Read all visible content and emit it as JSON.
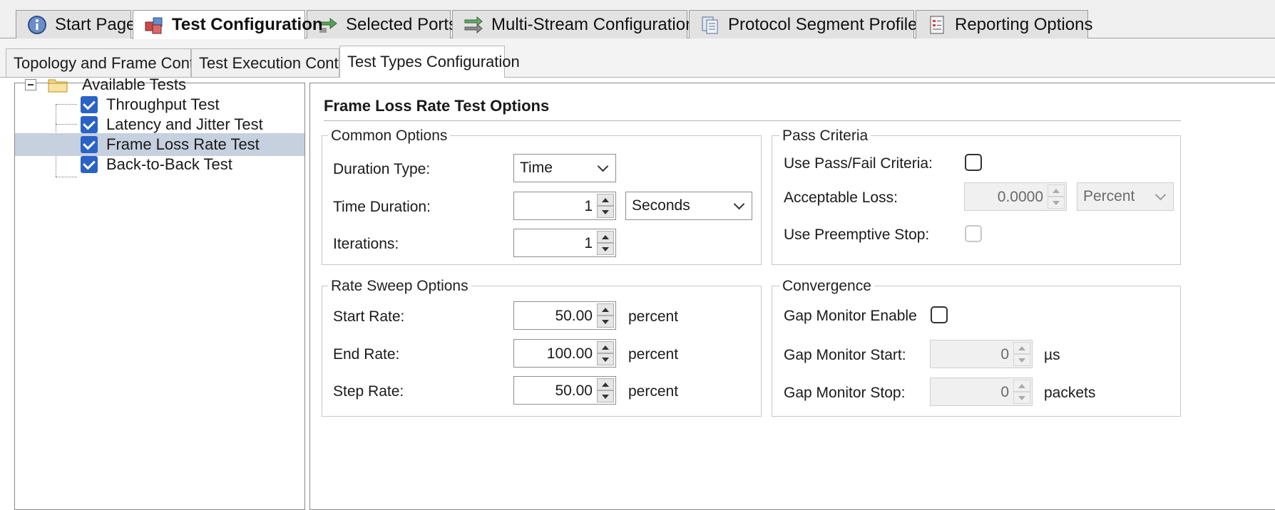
{
  "top_tabs": [
    {
      "label": "Start Page",
      "icon": "info-icon"
    },
    {
      "label": "Test Configuration",
      "icon": "cubes-icon",
      "active": true
    },
    {
      "label": "Selected Ports",
      "icon": "ports-arrows-icon"
    },
    {
      "label": "Multi-Stream Configuration",
      "icon": "multi-stream-icon"
    },
    {
      "label": "Protocol Segment Profiles",
      "icon": "documents-icon"
    },
    {
      "label": "Reporting Options",
      "icon": "report-icon"
    }
  ],
  "sub_tabs": [
    {
      "label": "Topology and Frame Content"
    },
    {
      "label": "Test Execution Control"
    },
    {
      "label": "Test Types Configuration",
      "active": true
    }
  ],
  "tree": {
    "root_label": "Available Tests",
    "items": [
      {
        "label": "Throughput Test",
        "checked": true
      },
      {
        "label": "Latency and Jitter Test",
        "checked": true
      },
      {
        "label": "Frame Loss Rate Test",
        "checked": true,
        "selected": true
      },
      {
        "label": "Back-to-Back Test",
        "checked": true
      }
    ]
  },
  "panel": {
    "title": "Frame Loss Rate Test Options",
    "common_options": {
      "group_label": "Common Options",
      "duration_type_label": "Duration Type:",
      "duration_type_value": "Time",
      "time_duration_label": "Time Duration:",
      "time_duration_value": "1",
      "time_unit_value": "Seconds",
      "iterations_label": "Iterations:",
      "iterations_value": "1"
    },
    "pass_criteria": {
      "group_label": "Pass Criteria",
      "use_pass_fail_label": "Use Pass/Fail Criteria:",
      "use_pass_fail_checked": false,
      "acceptable_loss_label": "Acceptable Loss:",
      "acceptable_loss_value": "0.0000",
      "acceptable_loss_unit": "Percent",
      "preemptive_stop_label": "Use Preemptive Stop:",
      "preemptive_stop_checked": false
    },
    "rate_sweep": {
      "group_label": "Rate Sweep Options",
      "start_rate_label": "Start Rate:",
      "start_rate_value": "50.00",
      "end_rate_label": "End Rate:",
      "end_rate_value": "100.00",
      "step_rate_label": "Step Rate:",
      "step_rate_value": "50.00",
      "unit": "percent"
    },
    "convergence": {
      "group_label": "Convergence",
      "gap_enable_label": "Gap Monitor Enable",
      "gap_enable_checked": false,
      "gap_start_label": "Gap Monitor Start:",
      "gap_start_value": "0",
      "gap_start_unit": "µs",
      "gap_stop_label": "Gap Monitor Stop:",
      "gap_stop_value": "0",
      "gap_stop_unit": "packets"
    }
  },
  "colors": {
    "selection": "#c6d0de",
    "checkbox_blue": "#2a63c6",
    "tab_inactive": "#e2e2e2"
  }
}
